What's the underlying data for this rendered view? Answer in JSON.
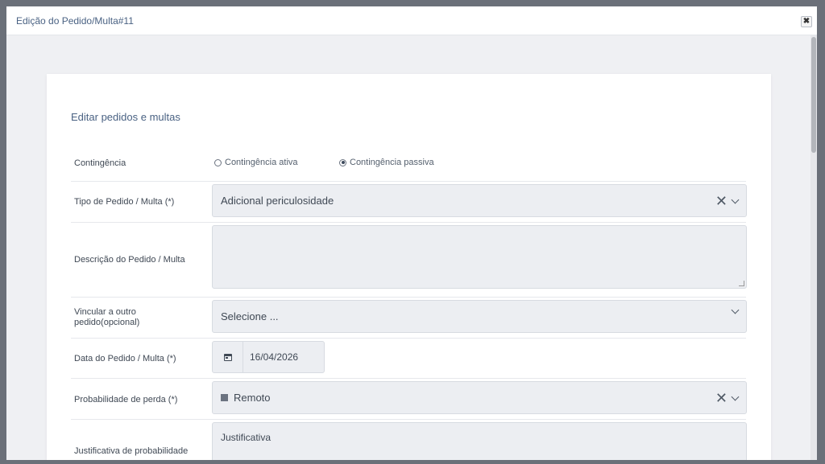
{
  "window": {
    "title": "Edição do Pedido/Multa#11",
    "close_label": "✖"
  },
  "form": {
    "heading": "Editar pedidos e multas",
    "contingencia": {
      "label": "Contingência",
      "option_ativa": "Contingência ativa",
      "option_passiva": "Contingência passiva",
      "selected": "Contingência passiva"
    },
    "tipo": {
      "label": "Tipo de Pedido / Multa (*)",
      "value": "Adicional periculosidade"
    },
    "descricao": {
      "label": "Descrição do Pedido / Multa",
      "value": ""
    },
    "vincular": {
      "label_line1": "Vincular a outro",
      "label_line2": "pedido(opcional)",
      "value": "Selecione ..."
    },
    "data": {
      "label": "Data do Pedido / Multa (*)",
      "value": "16/04/2026"
    },
    "probabilidade": {
      "label": "Probabilidade de perda (*)",
      "value": "Remoto"
    },
    "justificativa": {
      "label": "Justificativa de probabilidade",
      "placeholder": "Justificativa"
    }
  },
  "colors": {
    "accent": "#4a6283",
    "field_bg": "#eceef2",
    "backdrop": "#6b7079"
  },
  "icons": [
    "close-icon",
    "clear-icon",
    "chevron-down-icon",
    "calendar-icon",
    "square-icon",
    "resize-icon"
  ]
}
